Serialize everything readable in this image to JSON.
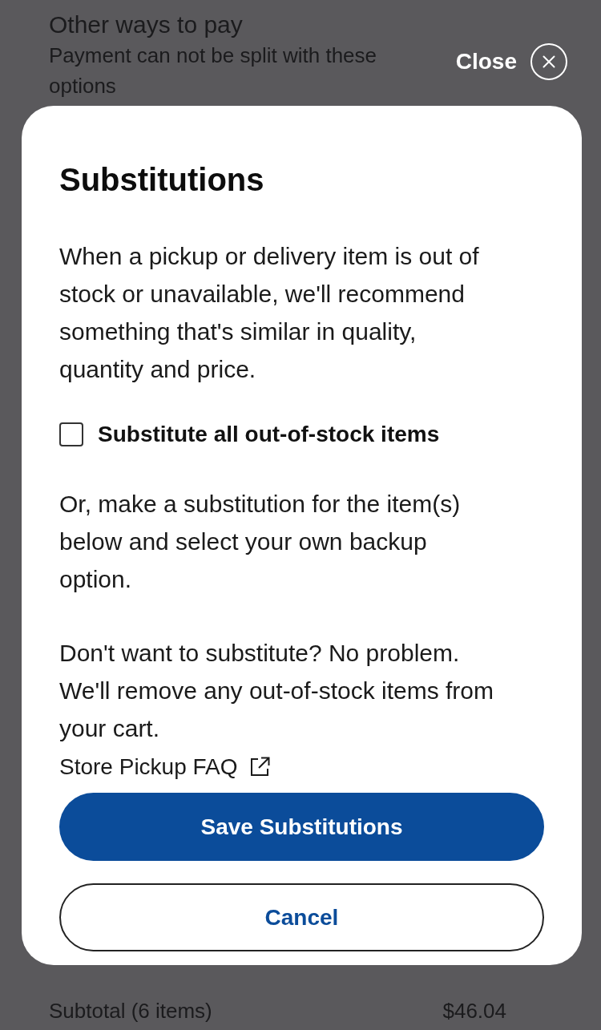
{
  "background_page": {
    "heading": "Other ways to pay",
    "note": "Payment can not be split with these options",
    "subtotal_label": "Subtotal (6 items)",
    "subtotal_value": "$46.04"
  },
  "close_button": {
    "label": "Close"
  },
  "dialog": {
    "title": "Substitutions",
    "intro": "When a pickup or delivery item is out of stock or unavailable, we'll recommend something that's similar in quality, quantity and price.",
    "checkbox": {
      "label": "Substitute all out-of-stock items",
      "checked": false
    },
    "paragraphs": [
      "Or, make a substitution for the item(s) below and select your own backup option.",
      "Don't want to substitute? No problem. We'll remove any out-of-stock items from your cart."
    ],
    "faq_link": {
      "label": "Store Pickup FAQ"
    },
    "buttons": [
      {
        "label": "Save Substitutions",
        "kind": "primary"
      },
      {
        "label": "Cancel",
        "kind": "secondary"
      }
    ]
  }
}
